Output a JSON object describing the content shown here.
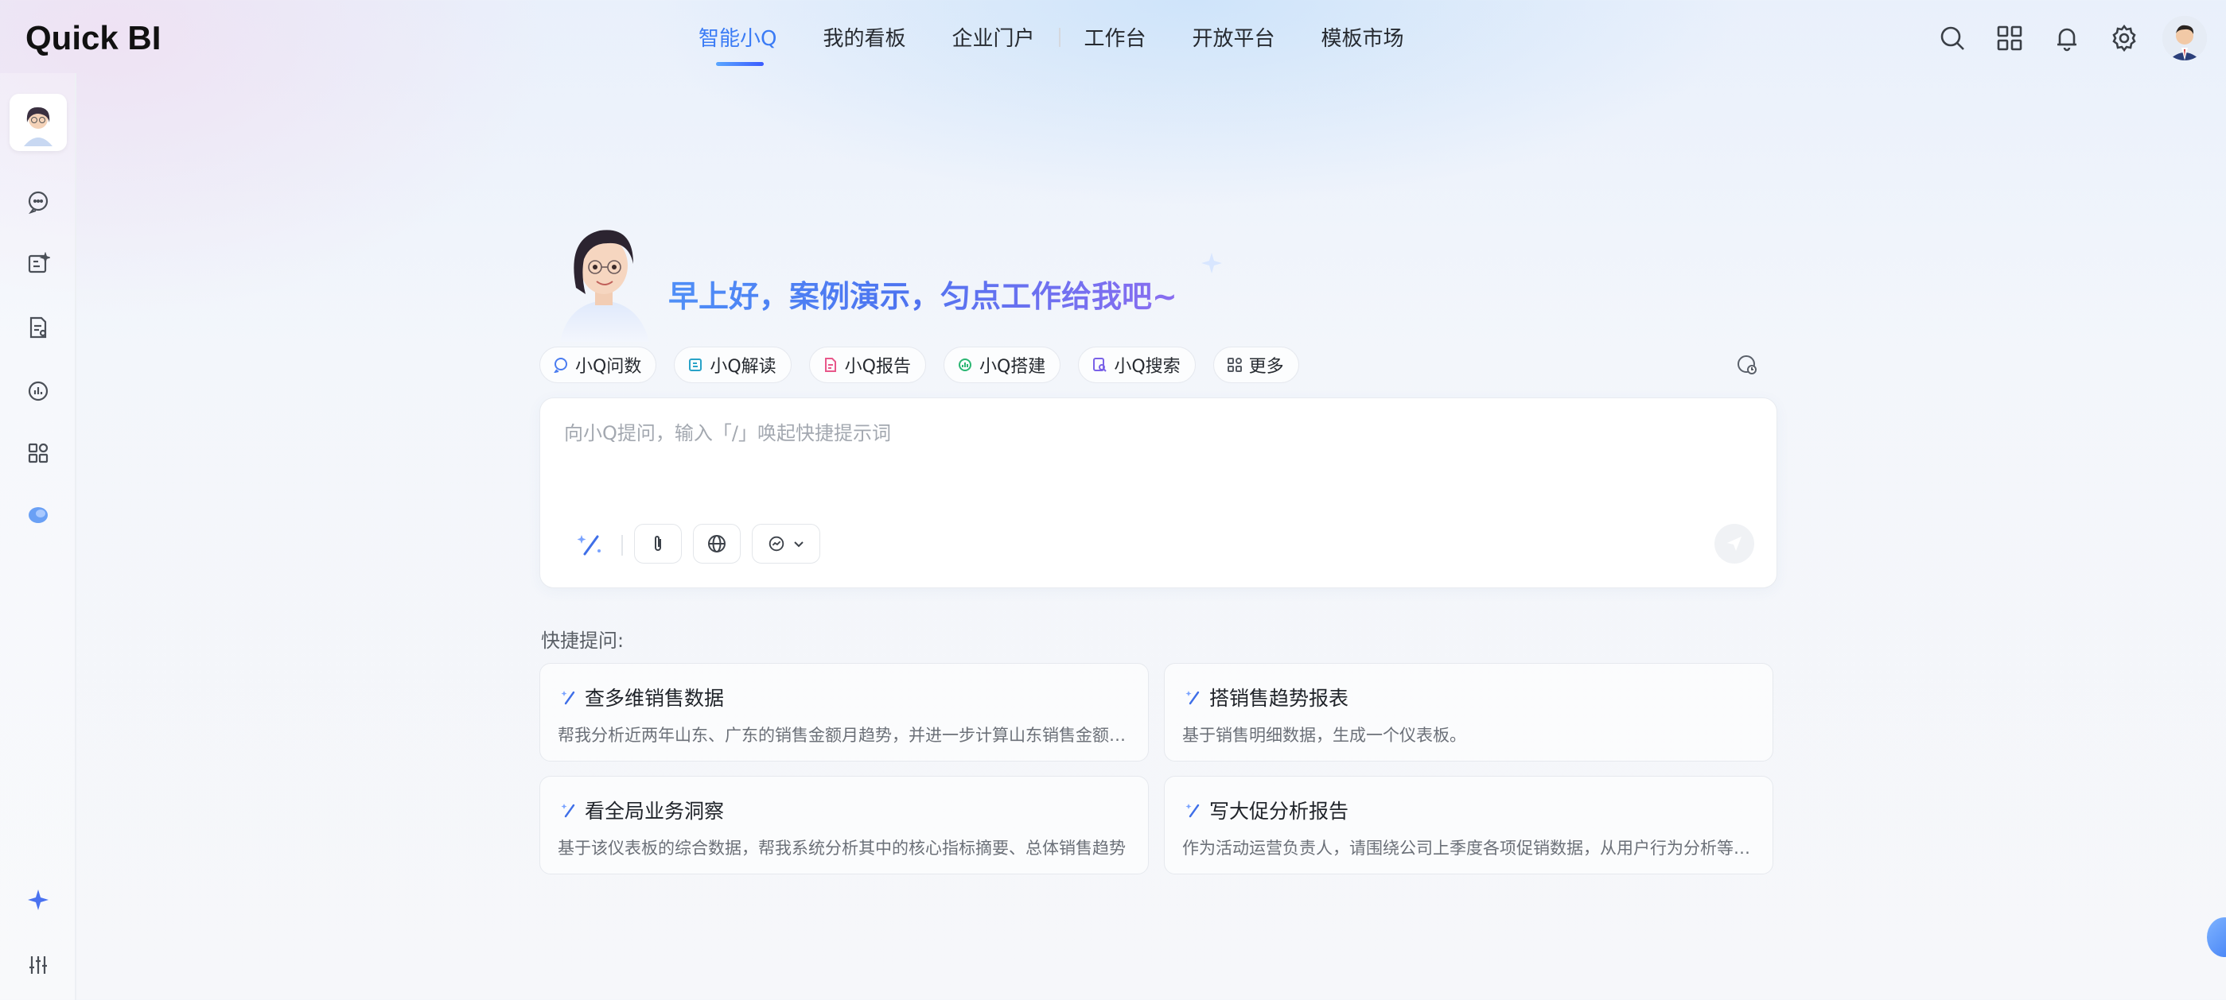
{
  "app": {
    "logo": "Quick BI"
  },
  "nav": {
    "items": [
      {
        "label": "智能小Q",
        "active": true
      },
      {
        "label": "我的看板"
      },
      {
        "label": "企业门户"
      },
      {
        "label": "工作台"
      },
      {
        "label": "开放平台"
      },
      {
        "label": "模板市场"
      }
    ]
  },
  "top_icons": [
    "search-icon",
    "apps-grid-icon",
    "bell-icon",
    "gear-icon",
    "user-avatar"
  ],
  "sidebar": {
    "items": [
      "chat-icon",
      "analysis-icon",
      "report-icon",
      "build-icon",
      "grid-icon",
      "blob-icon"
    ],
    "bottom": [
      "sparkle-icon",
      "sliders-icon"
    ]
  },
  "hero": {
    "greeting": "早上好，案例演示，匀点工作给我吧~"
  },
  "chips": [
    {
      "label": "小Q问数",
      "color": "#4a7cf0"
    },
    {
      "label": "小Q解读",
      "color": "#29a3c8"
    },
    {
      "label": "小Q报告",
      "color": "#e8578a"
    },
    {
      "label": "小Q搭建",
      "color": "#2bb673"
    },
    {
      "label": "小Q搜索",
      "color": "#7a62e8"
    },
    {
      "label": "更多",
      "color": "#555a62"
    }
  ],
  "input": {
    "placeholder": "向小Q提问，输入「/」唤起快捷提示词"
  },
  "quick": {
    "title": "快捷提问:",
    "cards": [
      {
        "title": "查多维销售数据",
        "desc": "帮我分析近两年山东、广东的销售金额月趋势，并进一步计算山东销售金额占比"
      },
      {
        "title": "搭销售趋势报表",
        "desc": "基于销售明细数据，生成一个仪表板。"
      },
      {
        "title": "看全局业务洞察",
        "desc": "基于该仪表板的综合数据，帮我系统分析其中的核心指标摘要、总体销售趋势"
      },
      {
        "title": "写大促分析报告",
        "desc": "作为活动运营负责人，请围绕公司上季度各项促销数据，从用户行为分析等方面"
      }
    ]
  },
  "colors": {
    "accent": "#3a7bf5",
    "greeting_start": "#4f8ff7",
    "greeting_end": "#8a6df0"
  }
}
